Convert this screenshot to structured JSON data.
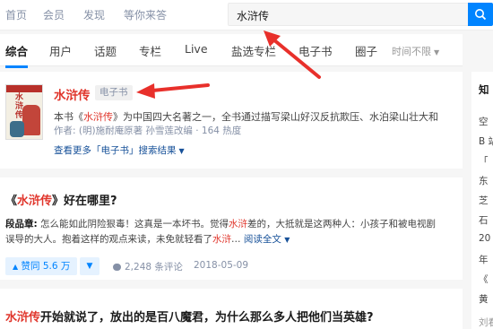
{
  "topnav": {
    "links": [
      "首页",
      "会员",
      "发现",
      "等你来答"
    ],
    "search_value": "水浒传"
  },
  "tabs": [
    "综合",
    "用户",
    "话题",
    "专栏",
    "Live",
    "盐选专栏",
    "电子书",
    "圈子"
  ],
  "time_filter": "时间不限",
  "book": {
    "cover_text": "水浒传",
    "title": "水浒传",
    "badge": "电子书",
    "desc_pre": "本书《",
    "desc_hl": "水浒传",
    "desc_post": "》为中国四大名著之一，全书通过描写梁山好汉反抗欺压、水泊梁山壮大和",
    "author": "作者: (明)施耐庵原著 孙雪莲改编 · 164 热度",
    "more": "查看更多「电子书」搜索结果"
  },
  "question1": {
    "pre": "《",
    "hl": "水浒传",
    "post": "》好在哪里?",
    "answer_author": "段品章:",
    "answer_line1a": " 怎么能如此阴险狠毒！这真是一本坏书。觉得",
    "answer_hl1": "水浒",
    "answer_line1b": "差的，大抵就是这两种人：小孩子和被电视剧",
    "answer_line2a": "误导的大人。抱着这样的观点来读，未免就轻看了",
    "answer_hl2": "水浒",
    "answer_line2b": "…",
    "read_more": "阅读全文",
    "vote": "赞同 5.6 万",
    "comments": "2,248 条评论",
    "date": "2018-05-09"
  },
  "question2": {
    "hl": "水浒传",
    "post": "开始就说了，放出的是百八魔君，为什么那么多人把他们当英雄?"
  },
  "sidebar": {
    "head": "知",
    "items": [
      "空",
      "B 站",
      "「",
      "东",
      "芝",
      "石",
      "20",
      "年",
      "《",
      "黄"
    ],
    "footer": "刘看"
  },
  "colors": {
    "accent": "#0084ff",
    "highlight": "#e0352b",
    "annotation": "#e8302b"
  }
}
